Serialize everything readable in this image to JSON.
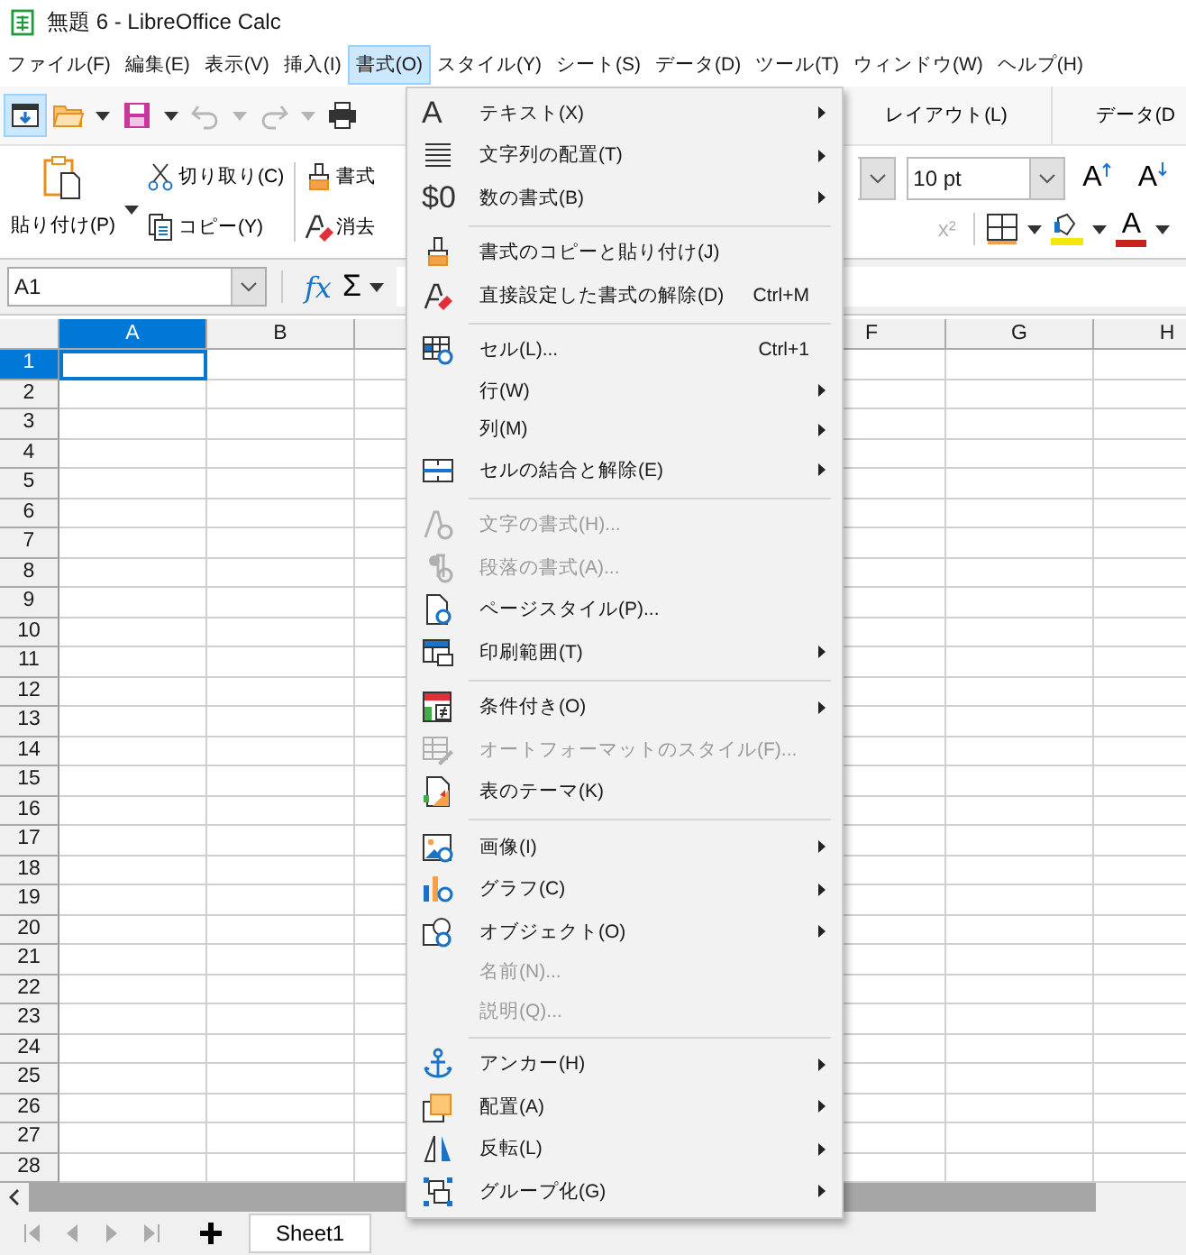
{
  "window": {
    "title": "無題 6 - LibreOffice Calc"
  },
  "menubar": [
    {
      "label": "ファイル(F)",
      "selected": false
    },
    {
      "label": "編集(E)",
      "selected": false
    },
    {
      "label": "表示(V)",
      "selected": false
    },
    {
      "label": "挿入(I)",
      "selected": false
    },
    {
      "label": "書式(O)",
      "selected": true
    },
    {
      "label": "スタイル(Y)",
      "selected": false
    },
    {
      "label": "シート(S)",
      "selected": false
    },
    {
      "label": "データ(D)",
      "selected": false
    },
    {
      "label": "ツール(T)",
      "selected": false
    },
    {
      "label": "ウィンドウ(W)",
      "selected": false
    },
    {
      "label": "ヘルプ(H)",
      "selected": false
    }
  ],
  "toolbar": {
    "buttons": [
      {
        "selected": true,
        "disabled": false,
        "dropdown": false
      },
      {
        "selected": false,
        "disabled": false,
        "dropdown": true
      },
      {
        "selected": false,
        "disabled": false,
        "dropdown": true
      },
      {
        "selected": false,
        "disabled": true,
        "dropdown": true
      },
      {
        "selected": false,
        "disabled": true,
        "dropdown": true
      },
      {
        "selected": false,
        "disabled": false,
        "dropdown": false
      }
    ],
    "tabs": [
      {
        "label": "レイアウト(L)"
      },
      {
        "label": "データ(D"
      }
    ]
  },
  "ribbon": {
    "paste": "貼り付け(P)",
    "cut": "切り取り(C)",
    "copy": "コピー(Y)",
    "clone": "書式",
    "clear": "消去",
    "font_size": "10 pt",
    "grow": "A",
    "shrink": "A",
    "superscript": {
      "label": "x²",
      "disabled": true
    },
    "font_color": "A"
  },
  "formula_bar": {
    "name_box": "A1",
    "function_wizard": "fx",
    "sum": "Σ"
  },
  "columns": [
    {
      "label": "A",
      "selected": true
    },
    {
      "label": "B",
      "selected": false
    },
    {
      "label": "F",
      "selected": false
    },
    {
      "label": "G",
      "selected": false
    },
    {
      "label": "H",
      "selected": false
    }
  ],
  "rows": [
    {
      "label": "1",
      "selected": true
    },
    {
      "label": "2",
      "selected": false
    },
    {
      "label": "3",
      "selected": false
    },
    {
      "label": "4",
      "selected": false
    },
    {
      "label": "5",
      "selected": false
    },
    {
      "label": "6",
      "selected": false
    },
    {
      "label": "7",
      "selected": false
    },
    {
      "label": "8",
      "selected": false
    },
    {
      "label": "9",
      "selected": false
    },
    {
      "label": "10",
      "selected": false
    },
    {
      "label": "11",
      "selected": false
    },
    {
      "label": "12",
      "selected": false
    },
    {
      "label": "13",
      "selected": false
    },
    {
      "label": "14",
      "selected": false
    },
    {
      "label": "15",
      "selected": false
    },
    {
      "label": "16",
      "selected": false
    },
    {
      "label": "17",
      "selected": false
    },
    {
      "label": "18",
      "selected": false
    },
    {
      "label": "19",
      "selected": false
    },
    {
      "label": "20",
      "selected": false
    },
    {
      "label": "21",
      "selected": false
    },
    {
      "label": "22",
      "selected": false
    },
    {
      "label": "23",
      "selected": false
    },
    {
      "label": "24",
      "selected": false
    },
    {
      "label": "25",
      "selected": false
    },
    {
      "label": "26",
      "selected": false
    },
    {
      "label": "27",
      "selected": false
    },
    {
      "label": "28",
      "selected": false
    }
  ],
  "sheet_tabs": [
    {
      "label": "Sheet1",
      "selected": true
    }
  ],
  "format_menu": {
    "groups": [
      [
        {
          "label": "テキスト(X)",
          "icon_text": "A",
          "submenu": true,
          "disabled": false
        },
        {
          "label": "文字列の配置(T)",
          "submenu": true,
          "disabled": false
        },
        {
          "label": "数の書式(B)",
          "icon_text": "$0",
          "submenu": true,
          "disabled": false
        }
      ],
      [
        {
          "label": "書式のコピーと貼り付け(J)",
          "submenu": false,
          "disabled": false
        },
        {
          "label": "直接設定した書式の解除(D)",
          "shortcut": "Ctrl+M",
          "submenu": false,
          "disabled": false
        }
      ],
      [
        {
          "label": "セル(L)...",
          "shortcut": "Ctrl+1",
          "submenu": false,
          "disabled": false
        },
        {
          "label": "行(W)",
          "submenu": true,
          "disabled": false
        },
        {
          "label": "列(M)",
          "submenu": true,
          "disabled": false
        },
        {
          "label": "セルの結合と解除(E)",
          "submenu": true,
          "disabled": false
        }
      ],
      [
        {
          "label": "文字の書式(H)...",
          "submenu": false,
          "disabled": true
        },
        {
          "label": "段落の書式(A)...",
          "submenu": false,
          "disabled": true
        },
        {
          "label": "ページスタイル(P)...",
          "submenu": false,
          "disabled": false
        },
        {
          "label": "印刷範囲(T)",
          "submenu": true,
          "disabled": false
        }
      ],
      [
        {
          "label": "条件付き(O)",
          "submenu": true,
          "disabled": false
        },
        {
          "label": "オートフォーマットのスタイル(F)...",
          "submenu": false,
          "disabled": true
        },
        {
          "label": "表のテーマ(K)",
          "submenu": false,
          "disabled": false
        }
      ],
      [
        {
          "label": "画像(I)",
          "submenu": true,
          "disabled": false
        },
        {
          "label": "グラフ(C)",
          "submenu": true,
          "disabled": false
        },
        {
          "label": "オブジェクト(O)",
          "submenu": true,
          "disabled": false
        },
        {
          "label": "名前(N)...",
          "submenu": false,
          "disabled": true
        },
        {
          "label": "説明(Q)...",
          "submenu": false,
          "disabled": true
        }
      ],
      [
        {
          "label": "アンカー(H)",
          "submenu": true,
          "disabled": false
        },
        {
          "label": "配置(A)",
          "submenu": true,
          "disabled": false
        },
        {
          "label": "反転(L)",
          "submenu": true,
          "disabled": false
        },
        {
          "label": "グループ化(G)",
          "submenu": true,
          "disabled": false
        }
      ]
    ]
  }
}
